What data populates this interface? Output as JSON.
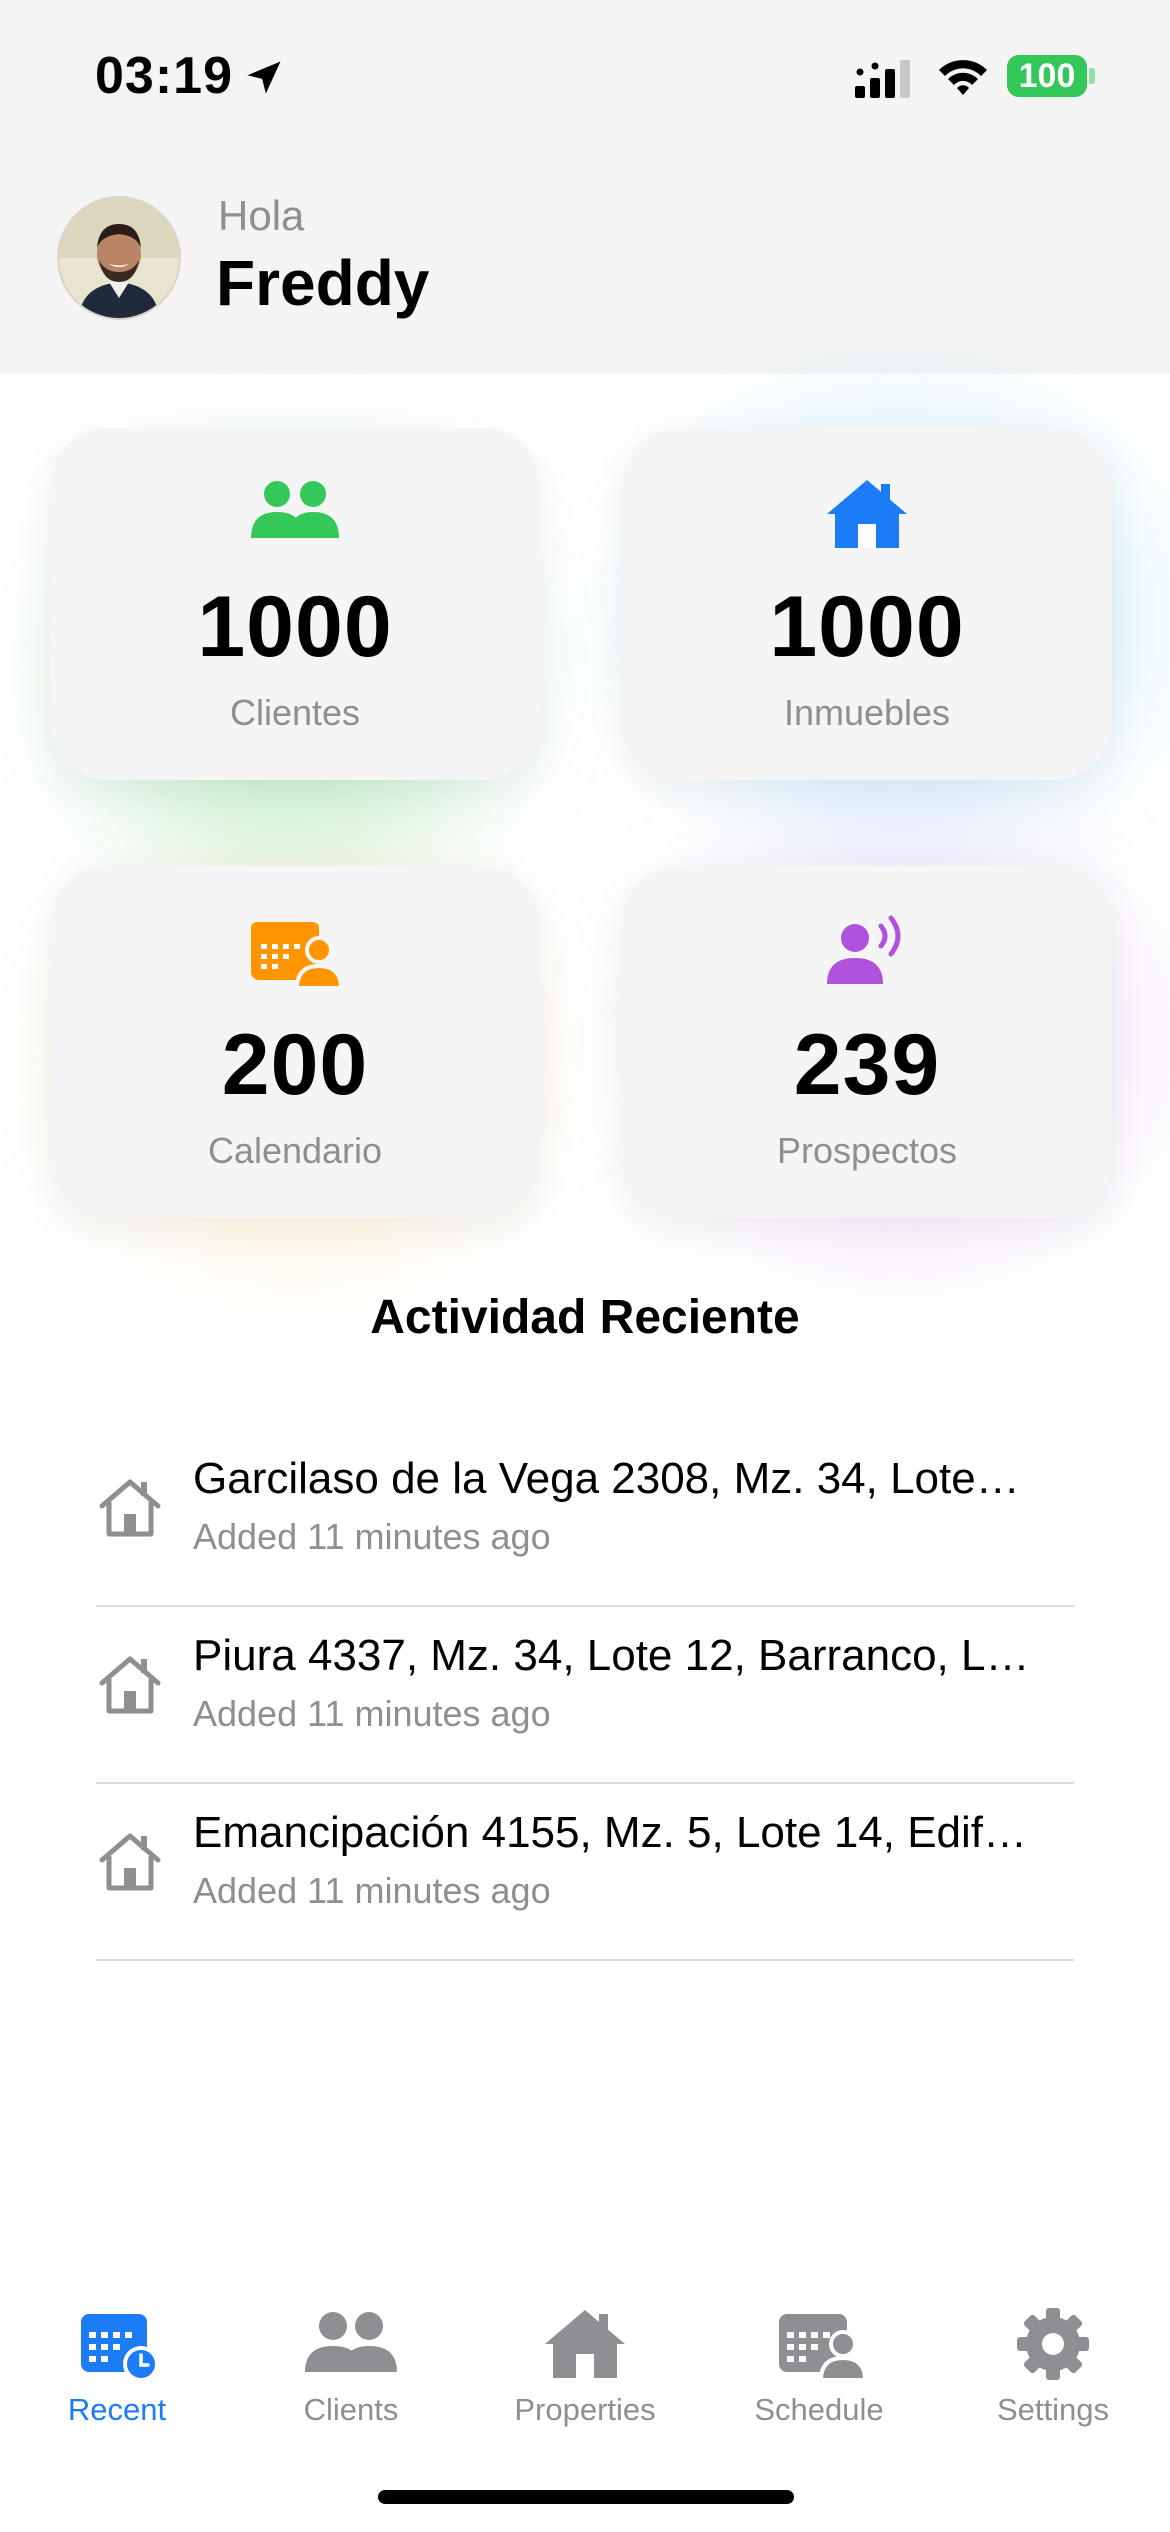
{
  "status_bar": {
    "time": "03:19",
    "battery": "100"
  },
  "header": {
    "greeting": "Hola",
    "user_name": "Freddy"
  },
  "stats": [
    {
      "value": "1000",
      "label": "Clientes",
      "icon": "clients-icon",
      "color": "#34c759"
    },
    {
      "value": "1000",
      "label": "Inmuebles",
      "icon": "house-icon",
      "color": "#1b7cf5"
    },
    {
      "value": "200",
      "label": "Calendario",
      "icon": "calendar-person-icon",
      "color": "#ff9500"
    },
    {
      "value": "239",
      "label": "Prospectos",
      "icon": "person-wave-icon",
      "color": "#af52de"
    }
  ],
  "activity": {
    "title": "Actividad Reciente",
    "items": [
      {
        "title": "Garcilaso de la Vega 2308, Mz. 34, Lote…",
        "subtitle": "Added 11 minutes ago"
      },
      {
        "title": "Piura 4337, Mz. 34, Lote 12, Barranco, L…",
        "subtitle": "Added 11 minutes ago"
      },
      {
        "title": "Emancipación 4155, Mz. 5, Lote 14, Edif…",
        "subtitle": "Added 11 minutes ago"
      }
    ]
  },
  "tabs": [
    {
      "label": "Recent",
      "active": true
    },
    {
      "label": "Clients",
      "active": false
    },
    {
      "label": "Properties",
      "active": false
    },
    {
      "label": "Schedule",
      "active": false
    },
    {
      "label": "Settings",
      "active": false
    }
  ],
  "colors": {
    "accent": "#1b7cf5",
    "inactive": "#8e8e93"
  }
}
